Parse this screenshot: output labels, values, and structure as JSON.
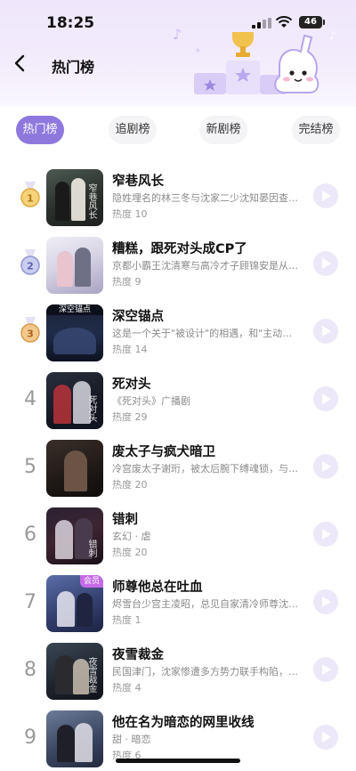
{
  "status_bar": {
    "time": "18:25",
    "battery": "46"
  },
  "nav": {
    "title": "热门榜"
  },
  "tabs": [
    {
      "label": "热门榜",
      "active": true
    },
    {
      "label": "追剧榜",
      "active": false
    },
    {
      "label": "新剧榜",
      "active": false
    },
    {
      "label": "完结榜",
      "active": false
    }
  ],
  "colors": {
    "accent": "#8e78de",
    "play_bg": "#ede8f9",
    "gold": "#e9b64a",
    "silver": "#9fa4d6",
    "bronze": "#e0a35c"
  },
  "items": [
    {
      "rank": "1",
      "medal": "gold-medal-icon",
      "title": "窄巷风长",
      "desc": "隐姓埋名的林三冬与沈家二少沈知晏因查账...",
      "heat": "热度 10",
      "cover_text": "窄巷风长"
    },
    {
      "rank": "2",
      "medal": "silver-medal-icon",
      "title": "糟糕，跟死对头成CP了",
      "desc": "京都小霸王沈清寒与高冷才子顾锦安是从小...",
      "heat": "热度 9",
      "cover_text": ""
    },
    {
      "rank": "3",
      "medal": "bronze-medal-icon",
      "title": "深空锚点",
      "desc": "这是一个关于\"被设计\"的相遇，和\"主动选...",
      "heat": "热度 14",
      "cover_text": "深空锚点"
    },
    {
      "rank": "4",
      "medal": "",
      "title": "死对头",
      "desc": "《死对头》广播剧",
      "heat": "热度 29",
      "cover_text": "死对头"
    },
    {
      "rank": "5",
      "medal": "",
      "title": "废太子与疯犬暗卫",
      "desc": "冷宫废太子谢珩，被太后腕下缚魂锁，与暗...",
      "heat": "热度 20",
      "cover_text": ""
    },
    {
      "rank": "6",
      "medal": "",
      "title": "错刺",
      "desc": "玄幻 · 虐",
      "heat": "热度 20",
      "cover_text": "错刺"
    },
    {
      "rank": "7",
      "medal": "",
      "title": "师尊他总在吐血",
      "desc": "烬雪台少宫主凌昭，总见自家清冷师尊沈清...",
      "heat": "热度 1",
      "cover_text": "",
      "tag": "会员"
    },
    {
      "rank": "8",
      "medal": "",
      "title": "夜雪裁金",
      "desc": "民国津门，沈家惨遭多方势力联手构陷，沈...",
      "heat": "热度 4",
      "cover_text": "夜雪裁金"
    },
    {
      "rank": "9",
      "medal": "",
      "title": "他在名为暗恋的网里收线",
      "desc": "甜 · 暗恋",
      "heat": "热度 6",
      "cover_text": ""
    }
  ]
}
